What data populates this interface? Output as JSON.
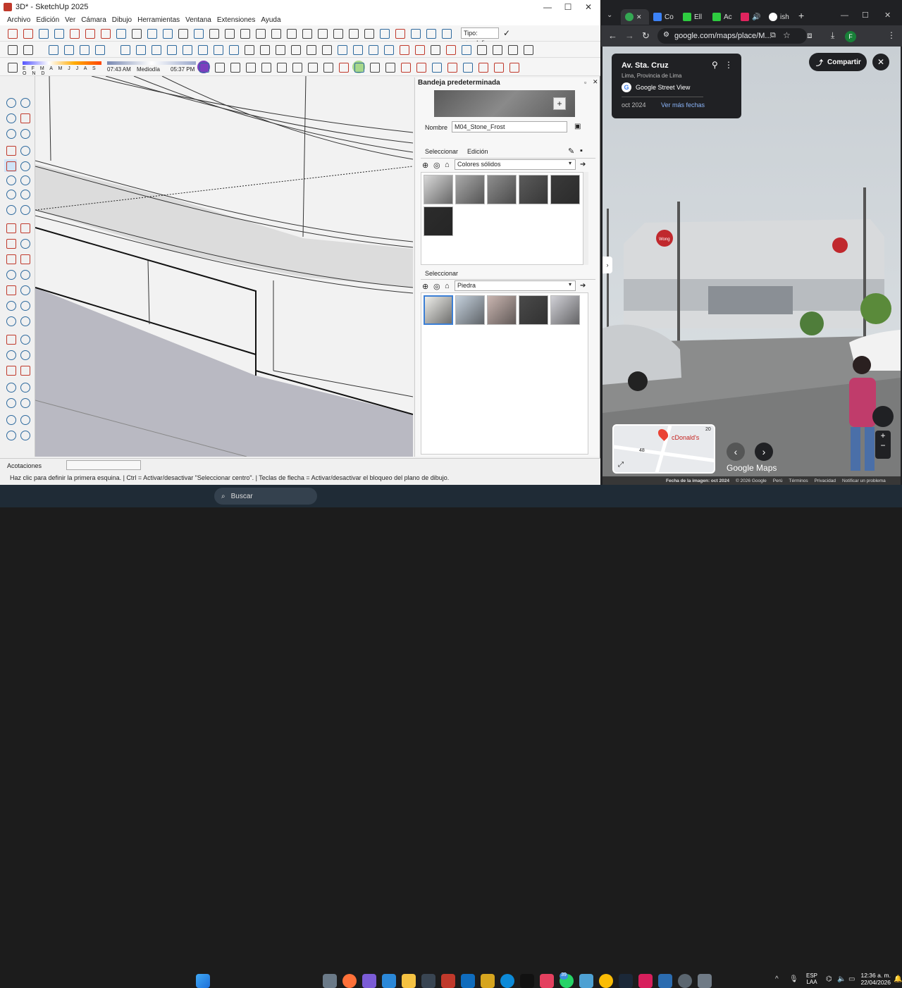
{
  "sketchup": {
    "title": "3D* - SketchUp 2025",
    "window_buttons": [
      "—",
      "☐",
      "✕"
    ],
    "menu": [
      "Archivo",
      "Edición",
      "Ver",
      "Cámara",
      "Dibujo",
      "Herramientas",
      "Ventana",
      "Extensiones",
      "Ayuda"
    ],
    "type_field": "Tipo: <undefi",
    "shadow_months": "E F M A M J J A S O N D",
    "shadow_time_start": "07:43 AM",
    "shadow_time_mid": "Mediodía",
    "shadow_time_end": "05:37 PM",
    "tray": {
      "title": "Bandeja predeterminada",
      "name_label": "Nombre",
      "name_value": "M04_Stone_Frost",
      "tab_select": "Seleccionar",
      "tab_edit": "Edición",
      "library1": "Colores sólidos",
      "swatches1": [
        "#d8d8d8",
        "#a9a9a9",
        "#8e8e8e",
        "#5b5b5b",
        "#3a3a3a",
        "#2c2c2c"
      ],
      "select_label2": "Seleccionar",
      "library2": "Piedra",
      "swatches2": [
        "#eeeeea",
        "#c4d0dc",
        "#c9b5b0",
        "#4a4a4a",
        "#d0d0d6"
      ]
    },
    "status_label": "Acotaciones",
    "status_hint": "Haz clic para definir la primera esquina. | Ctrl = Activar/desactivar \"Seleccionar centro\". | Teclas de flecha = Activar/desactivar el bloqueo del plano de dibujo."
  },
  "browser": {
    "tabs": [
      "Co",
      "Ell",
      "Ac",
      "ish"
    ],
    "url": "google.com/maps/place/M...",
    "profile_initial": "F",
    "maps": {
      "place": "Av. Sta. Cruz",
      "region": "Lima, Provincia de Lima",
      "source": "Google Street View",
      "date": "oct 2024",
      "more_dates": "Ver más fechas",
      "share": "Compartir",
      "minimap_label": "cDonald's",
      "minimap_num1": "20",
      "minimap_num2": "48",
      "logo": "Google Maps",
      "footer": [
        "Fecha de la imagen: oct 2024",
        "© 2026 Google",
        "Perú",
        "Términos",
        "Privacidad",
        "Notificar un problema"
      ],
      "store_sign": "Wong"
    }
  },
  "taskbar": {
    "search": "Buscar",
    "badge": "39",
    "lang1": "ESP",
    "lang2": "LAA",
    "time": "12:36 a. m.",
    "date": "22/04/2026"
  }
}
